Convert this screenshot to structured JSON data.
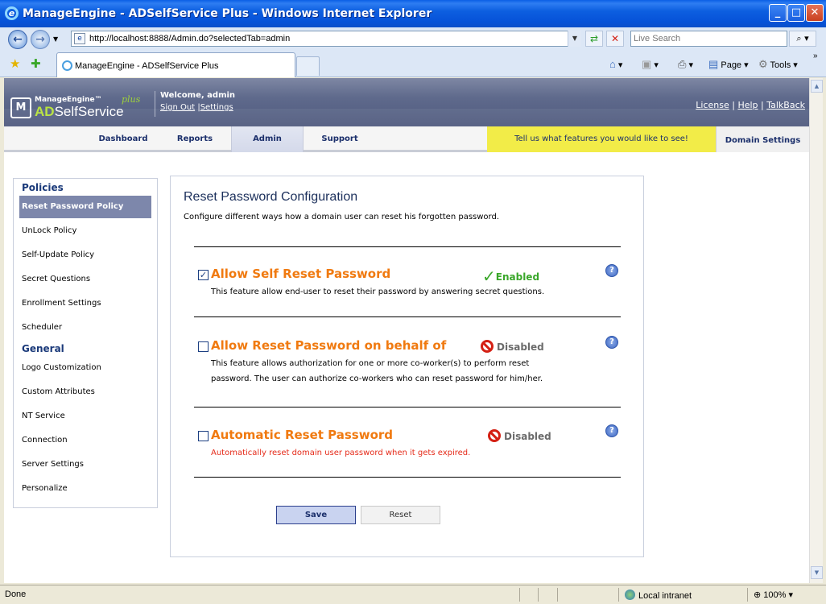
{
  "window": {
    "title": "ManageEngine - ADSelfService Plus - Windows Internet Explorer",
    "url": "http://localhost:8888/Admin.do?selectedTab=admin",
    "search_placeholder": "Live Search",
    "tab_title": "ManageEngine - ADSelfService Plus",
    "page_menu": "Page",
    "tools_menu": "Tools"
  },
  "app": {
    "brand_small": "ManageEngine™",
    "brand_ad": "AD",
    "brand_rest": "SelfService",
    "brand_plus": "plus",
    "welcome": "Welcome,  admin",
    "sign_out": "Sign Out",
    "settings": "Settings",
    "top_links": [
      "License",
      "Help",
      "TalkBack"
    ]
  },
  "nav": {
    "tabs": [
      "Dashboard",
      "Reports",
      "Admin",
      "Support"
    ],
    "active": "Admin",
    "feature_banner": "Tell us what features you would like to see!",
    "domain_settings": "Domain Settings"
  },
  "sidebar": {
    "policies_header": "Policies",
    "policies": [
      "Reset Password Policy",
      "UnLock Policy",
      "Self-Update Policy",
      "Secret Questions",
      "Enrollment Settings",
      "Scheduler"
    ],
    "general_header": "General",
    "general": [
      "Logo Customization",
      "Custom Attributes",
      "NT Service",
      "Connection",
      "Server Settings",
      "Personalize"
    ]
  },
  "main": {
    "title": "Reset Password Configuration",
    "description": "Configure different ways how a domain user can reset his forgotten password.",
    "options": [
      {
        "title": "Allow Self Reset Password",
        "checked": true,
        "status": "Enabled",
        "desc1": "This feature allow end-user to reset their password by answering secret questions.",
        "desc2": ""
      },
      {
        "title": "Allow Reset Password on behalf of",
        "checked": false,
        "status": "Disabled",
        "desc1": "This feature allows authorization for one or more co-worker(s) to perform reset",
        "desc2": "password. The user can authorize co-workers who can reset password for him/her."
      },
      {
        "title": "Automatic Reset Password",
        "checked": false,
        "status": "Disabled",
        "desc1": "Automatically reset domain user password when it gets expired.",
        "desc2": ""
      }
    ],
    "save_label": "Save",
    "reset_label": "Reset"
  },
  "statusbar": {
    "done": "Done",
    "zone": "Local intranet",
    "zoom": "100%"
  }
}
